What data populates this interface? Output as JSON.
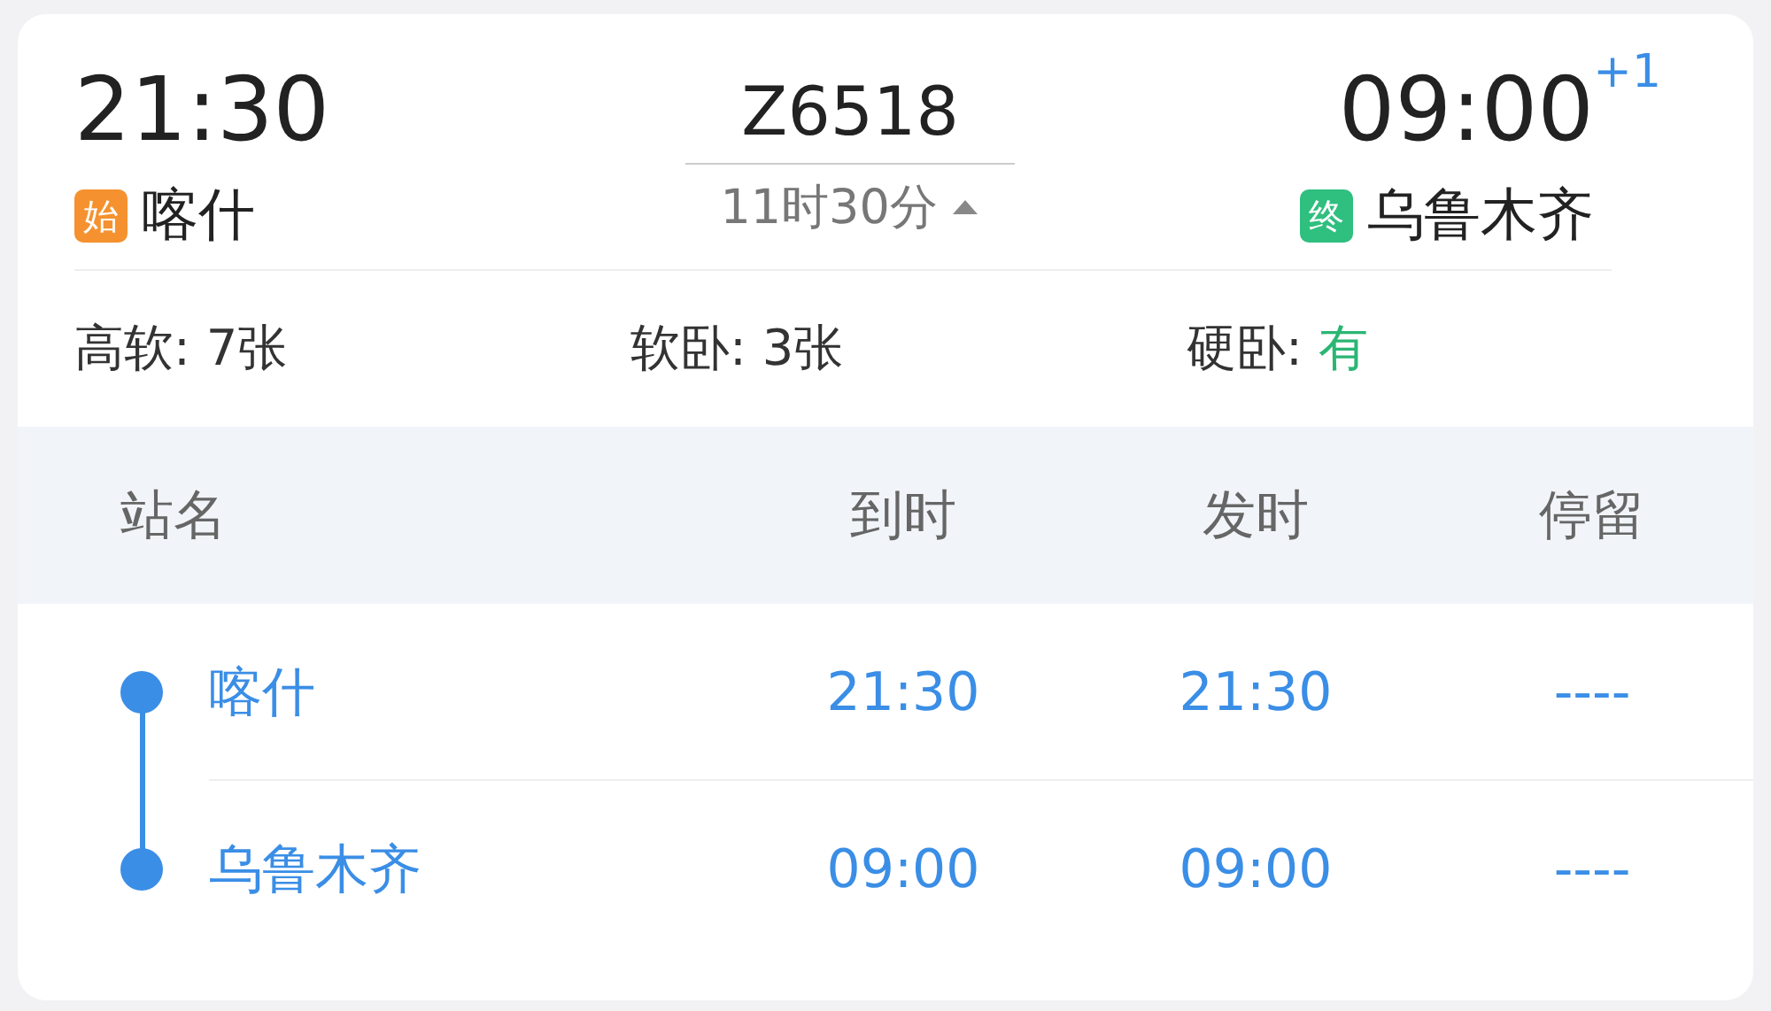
{
  "departure": {
    "time": "21:30",
    "badge": "始",
    "station": "喀什"
  },
  "train": {
    "number": "Z6518",
    "duration": "11时30分",
    "expanded": true
  },
  "arrival": {
    "time": "09:00",
    "day_offset": "+1",
    "badge": "终",
    "station": "乌鲁木齐"
  },
  "seats": [
    {
      "label": "高软: ",
      "value": "7张",
      "available": false
    },
    {
      "label": "软卧: ",
      "value": "3张",
      "available": false
    },
    {
      "label": "硬卧: ",
      "value": "有",
      "available": true
    }
  ],
  "table": {
    "columns": [
      "站名",
      "到时",
      "发时",
      "停留"
    ],
    "rows": [
      {
        "station": "喀什",
        "arrive": "21:30",
        "depart": "21:30",
        "stay": "----"
      },
      {
        "station": "乌鲁木齐",
        "arrive": "09:00",
        "depart": "09:00",
        "stay": "----"
      }
    ]
  }
}
